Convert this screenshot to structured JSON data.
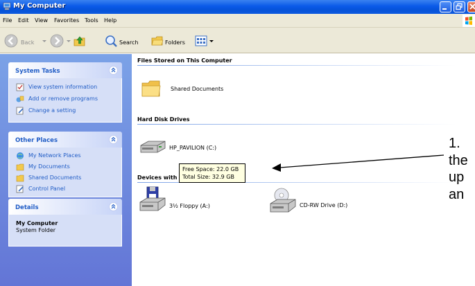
{
  "window": {
    "title": "My Computer"
  },
  "menubar": {
    "items": [
      "File",
      "Edit",
      "View",
      "Favorites",
      "Tools",
      "Help"
    ]
  },
  "toolbar": {
    "back_label": "Back",
    "search_label": "Search",
    "folders_label": "Folders"
  },
  "sidebar": {
    "system_tasks": {
      "title": "System Tasks",
      "items": [
        "View system information",
        "Add or remove programs",
        "Change a setting"
      ]
    },
    "other_places": {
      "title": "Other Places",
      "items": [
        "My Network Places",
        "My Documents",
        "Shared Documents",
        "Control Panel"
      ]
    },
    "details": {
      "title": "Details",
      "name": "My Computer",
      "type": "System Folder"
    }
  },
  "content": {
    "groups": {
      "files_stored": "Files Stored on This Computer",
      "hard_disk": "Hard Disk Drives",
      "devices": "Devices with"
    },
    "items": {
      "shared_documents": "Shared Documents",
      "hp_pavilion": "HP_PAVILION (C:)",
      "floppy": "3½ Floppy (A:)",
      "cdrw": "CD-RW Drive (D:)"
    },
    "tooltip": {
      "free_space": "Free Space: 22.0 GB",
      "total_size": "Total Size: 32.9 GB"
    }
  },
  "annotation": {
    "lines": [
      "1.",
      "the",
      "up",
      "an"
    ]
  },
  "colors": {
    "title_bar": "#0a5ae8",
    "sidebar_link": "#215dc6",
    "tooltip_bg": "#ffffe1"
  }
}
